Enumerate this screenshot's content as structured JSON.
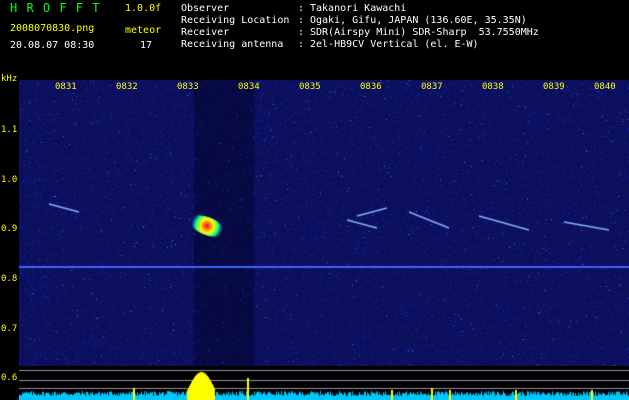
{
  "app": {
    "name": "H R O F F T",
    "version": "1.0.0f",
    "filename": "2008070830.png",
    "datetime": "20.08.07 08:30",
    "mode": "meteor",
    "count": "17"
  },
  "info": {
    "labels": [
      "Observer",
      "Receiving Location",
      "Receiver",
      "Receiving antenna"
    ],
    "values": [
      "Takanori Kawachi",
      "Ogaki, Gifu, JAPAN (136.60E, 35.35N)",
      "SDR(Airspy Mini) SDR-Sharp  53.7550MHz",
      "2el-HB9CV Vertical (el. E-W)"
    ]
  },
  "spectrogram": {
    "yunit": "kHz",
    "yticks": [
      "1.1",
      "1.0",
      "0.9",
      "0.8",
      "0.7",
      "0.6"
    ],
    "xticks": [
      "0831",
      "0832",
      "0833",
      "0834",
      "0835",
      "0836",
      "0837",
      "0838",
      "0839",
      "0840"
    ],
    "colors": {
      "bg": "#0b0f5c",
      "accent": "#ffff00",
      "level": "#00c8ff"
    }
  }
}
